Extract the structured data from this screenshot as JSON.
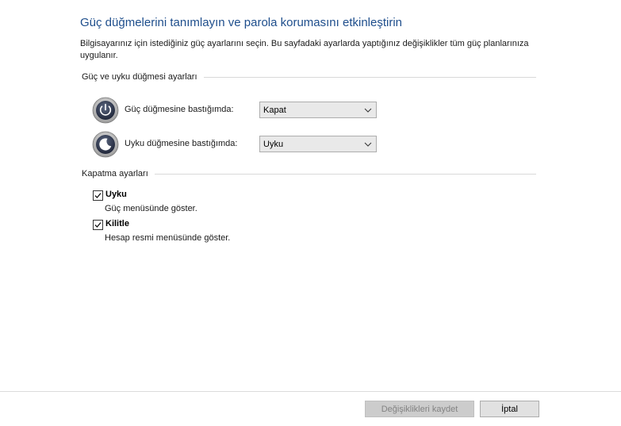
{
  "header": {
    "title": "Güç düğmelerini tanımlayın ve parola korumasını etkinleştirin",
    "description": "Bilgisayarınız için istediğiniz güç ayarlarını seçin. Bu sayfadaki ayarlarda yaptığınız değişiklikler tüm güç planlarınıza uygulanır."
  },
  "power_buttons": {
    "group_title": "Güç ve uyku düğmesi ayarları",
    "power_button": {
      "label": "Güç düğmesine bastığımda:",
      "value": "Kapat",
      "icon": "power-icon"
    },
    "sleep_button": {
      "label": "Uyku düğmesine bastığımda:",
      "value": "Uyku",
      "icon": "sleep-icon"
    }
  },
  "shutdown": {
    "group_title": "Kapatma ayarları",
    "items": [
      {
        "label": "Uyku",
        "description": "Güç menüsünde göster.",
        "checked": true
      },
      {
        "label": "Kilitle",
        "description": "Hesap resmi menüsünde göster.",
        "checked": true
      }
    ]
  },
  "footer": {
    "save_label": "Değişiklikleri kaydet",
    "cancel_label": "İptal"
  },
  "colors": {
    "title": "#1e4e8c",
    "separator": "#d9d9d9",
    "button_disabled_bg": "#cccccc",
    "button_bg": "#e1e1e1"
  }
}
